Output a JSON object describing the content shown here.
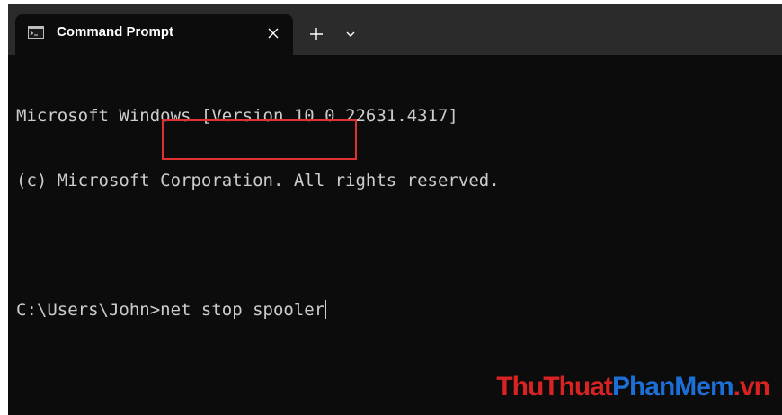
{
  "window": {
    "tab_title": "Command Prompt"
  },
  "icons": {
    "tab_icon": "cmd-icon",
    "close": "close-icon",
    "new_tab": "plus-icon",
    "dropdown": "chevron-down-icon"
  },
  "terminal": {
    "line1": "Microsoft Windows [Version 10.0.22631.4317]",
    "line2": "(c) Microsoft Corporation. All rights reserved.",
    "prompt": "C:\\Users\\John>",
    "command": "net stop spooler"
  },
  "watermark": {
    "part1": "ThuThuat",
    "part2": "PhanMem",
    "part3": ".vn"
  },
  "colors": {
    "terminal_bg": "#0c0c0c",
    "titlebar_bg": "#2b2b2b",
    "text": "#cccccc",
    "highlight": "#e03131",
    "watermark_red": "#d92323",
    "watermark_blue": "#1c6fd6"
  }
}
